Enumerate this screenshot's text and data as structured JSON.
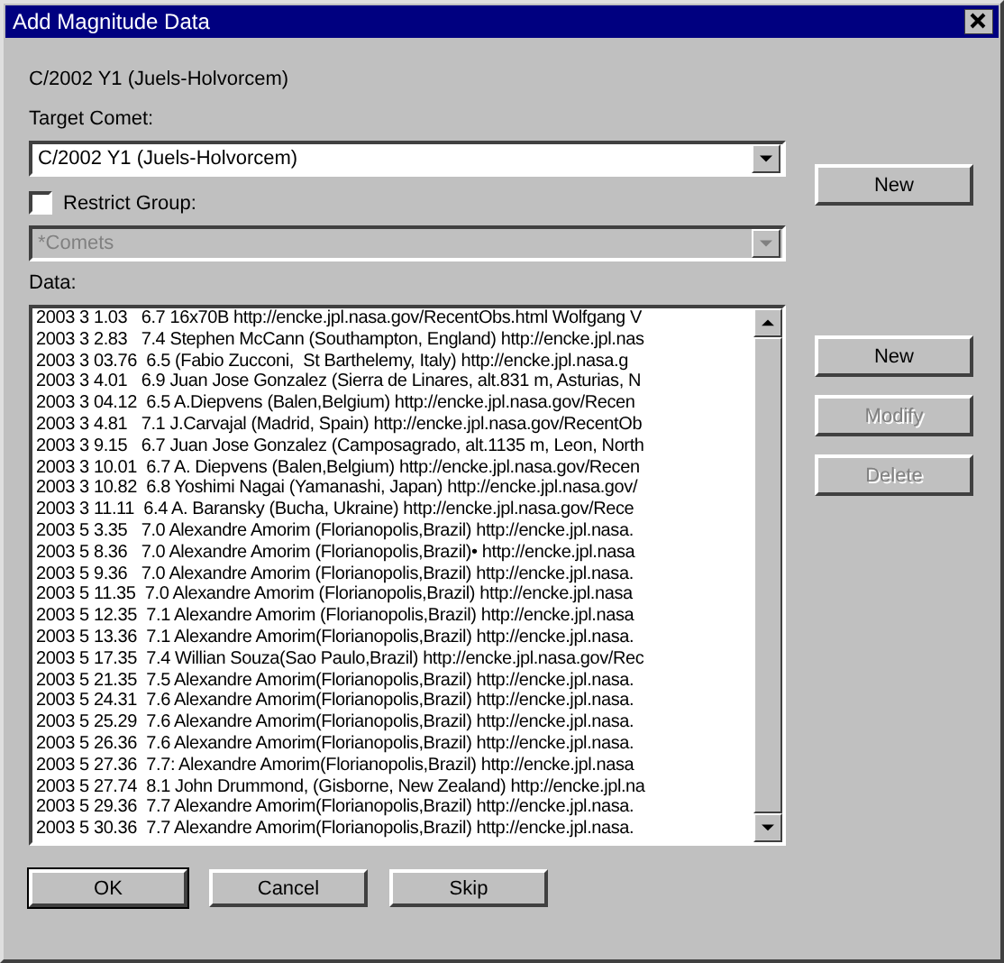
{
  "window": {
    "title": "Add Magnitude Data"
  },
  "comet_heading": "C/2002 Y1 (Juels-Holvorcem)",
  "target_comet": {
    "label": "Target Comet:",
    "value": "C/2002 Y1 (Juels-Holvorcem)",
    "disabled": false,
    "button": {
      "label": "New",
      "disabled": false
    }
  },
  "restrict_group": {
    "label": "Restrict Group:",
    "checked": false,
    "value": "*Comets",
    "disabled": true
  },
  "data": {
    "label": "Data:",
    "rows": [
      "2003 3 1.03   6.7 16x70B http://encke.jpl.nasa.gov/RecentObs.html Wolfgang V",
      "2003 3 2.83   7.4 Stephen McCann (Southampton, England) http://encke.jpl.nas",
      "2003 3 03.76  6.5 (Fabio Zucconi,  St Barthelemy, Italy) http://encke.jpl.nasa.g",
      "2003 3 4.01   6.9 Juan Jose Gonzalez (Sierra de Linares, alt.831 m, Asturias, N",
      "2003 3 04.12  6.5 A.Diepvens (Balen,Belgium) http://encke.jpl.nasa.gov/Recen",
      "2003 3 4.81   7.1 J.Carvajal (Madrid, Spain) http://encke.jpl.nasa.gov/RecentOb",
      "2003 3 9.15   6.7 Juan Jose Gonzalez (Camposagrado, alt.1135 m, Leon, North",
      "2003 3 10.01  6.7 A. Diepvens (Balen,Belgium) http://encke.jpl.nasa.gov/Recen",
      "2003 3 10.82  6.8 Yoshimi Nagai (Yamanashi, Japan) http://encke.jpl.nasa.gov/",
      "2003 3 11.11  6.4 A. Baransky (Bucha, Ukraine) http://encke.jpl.nasa.gov/Rece",
      "2003 5 3.35   7.0 Alexandre Amorim (Florianopolis,Brazil) http://encke.jpl.nasa.",
      "2003 5 8.36   7.0 Alexandre Amorim (Florianopolis,Brazil)• http://encke.jpl.nasa",
      "2003 5 9.36   7.0 Alexandre Amorim (Florianopolis,Brazil) http://encke.jpl.nasa.",
      "2003 5 11.35  7.0 Alexandre Amorim (Florianopolis,Brazil) http://encke.jpl.nasa",
      "2003 5 12.35  7.1 Alexandre Amorim (Florianopolis,Brazil) http://encke.jpl.nasa",
      "2003 5 13.36  7.1 Alexandre Amorim(Florianopolis,Brazil) http://encke.jpl.nasa.",
      "2003 5 17.35  7.4 Willian Souza(Sao Paulo,Brazil) http://encke.jpl.nasa.gov/Rec",
      "2003 5 21.35  7.5 Alexandre Amorim(Florianopolis,Brazil) http://encke.jpl.nasa.",
      "2003 5 24.31  7.6 Alexandre Amorim(Florianopolis,Brazil) http://encke.jpl.nasa.",
      "2003 5 25.29  7.6 Alexandre Amorim(Florianopolis,Brazil) http://encke.jpl.nasa.",
      "2003 5 26.36  7.6 Alexandre Amorim(Florianopolis,Brazil) http://encke.jpl.nasa.",
      "2003 5 27.36  7.7: Alexandre Amorim(Florianopolis,Brazil) http://encke.jpl.nasa",
      "2003 5 27.74  8.1 John Drummond, (Gisborne, New Zealand) http://encke.jpl.na",
      "2003 5 29.36  7.7 Alexandre Amorim(Florianopolis,Brazil) http://encke.jpl.nasa.",
      "2003 5 30.36  7.7 Alexandre Amorim(Florianopolis,Brazil) http://encke.jpl.nasa."
    ],
    "buttons": [
      {
        "label": "New",
        "disabled": false
      },
      {
        "label": "Modify",
        "disabled": true
      },
      {
        "label": "Delete",
        "disabled": true
      }
    ]
  },
  "footer_buttons": [
    {
      "label": "OK",
      "default": true
    },
    {
      "label": "Cancel",
      "default": false
    },
    {
      "label": "Skip",
      "default": false
    }
  ]
}
